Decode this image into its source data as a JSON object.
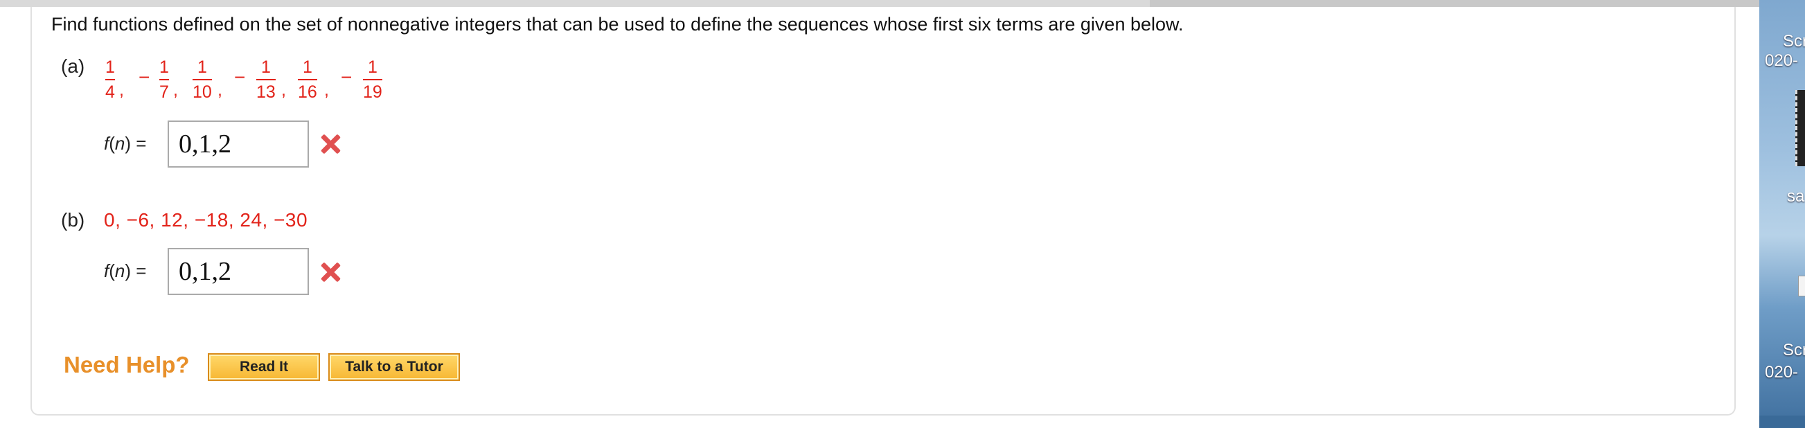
{
  "question": {
    "prompt": "Find functions defined on the set of nonnegative integers that can be used to define the sequences whose first six terms are given below."
  },
  "part_a": {
    "label": "(a)",
    "fractions": [
      {
        "sign": "",
        "num": "1",
        "den": "4"
      },
      {
        "sign": "−",
        "num": "1",
        "den": "7"
      },
      {
        "sign": "",
        "num": "1",
        "den": "10"
      },
      {
        "sign": "−",
        "num": "1",
        "den": "13"
      },
      {
        "sign": "",
        "num": "1",
        "den": "16"
      },
      {
        "sign": "−",
        "num": "1",
        "den": "19"
      }
    ],
    "func_label_f": "f",
    "func_label_n": "n",
    "answer_value": "0,1,2",
    "status": "incorrect"
  },
  "part_b": {
    "label": "(b)",
    "sequence": "0, −6, 12, −18, 24, −30",
    "func_label_f": "f",
    "func_label_n": "n",
    "answer_value": "0,1,2",
    "status": "incorrect"
  },
  "help": {
    "need_help": "Need Help?",
    "read_it": "Read It",
    "talk_to_tutor": "Talk to a Tutor"
  },
  "desktop": {
    "item1": "Scr",
    "item1_sub": "020-",
    "item2": "sa",
    "item3": "Scr",
    "item3_sub": "020-"
  },
  "colors": {
    "accent_red": "#e2231a",
    "help_orange": "#e8902a",
    "button_fill": "#f7b733"
  }
}
